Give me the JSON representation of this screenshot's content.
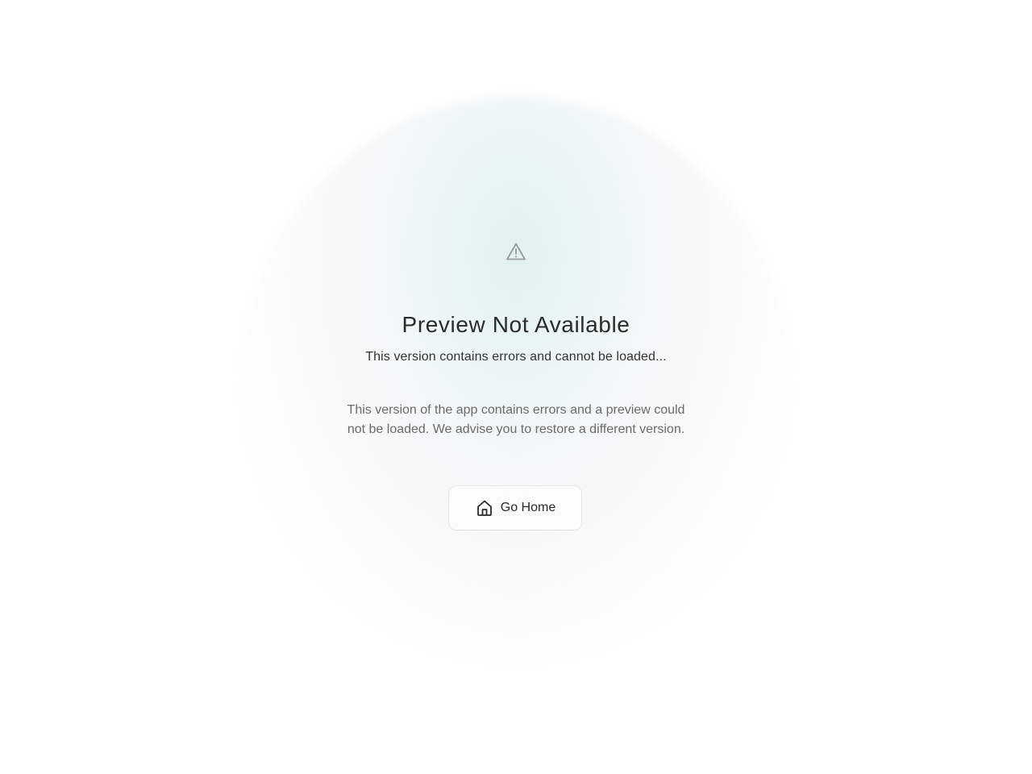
{
  "error": {
    "icon": "warning-triangle-icon",
    "title": "Preview Not Available",
    "subtitle": "This version contains errors and cannot be loaded...",
    "description": "This version of the app contains errors and a preview could not be loaded. We advise you to restore a different version."
  },
  "actions": {
    "home_label": "Go Home",
    "home_icon": "home-icon"
  },
  "colors": {
    "glow": "#dcefee",
    "text_primary": "#2b2b2b",
    "text_secondary": "#6b6b6b",
    "icon": "#9a9a9a"
  }
}
